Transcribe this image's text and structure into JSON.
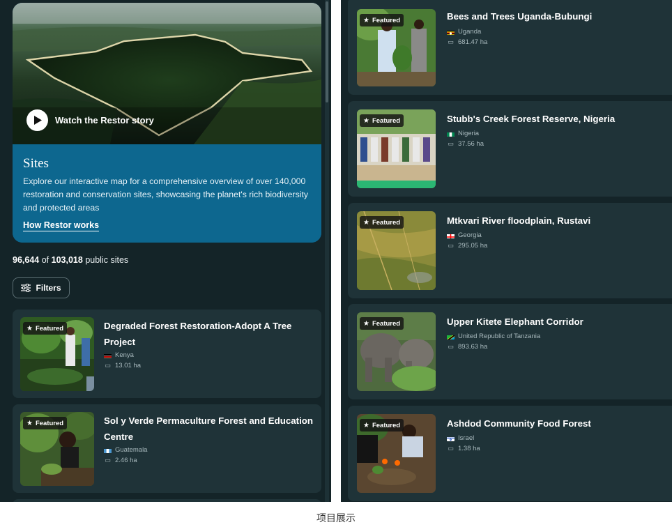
{
  "hero": {
    "watch_label": "Watch the Restor story",
    "title": "Sites",
    "description": "Explore our interactive map for a comprehensive overview of over 140,000 restoration and conservation sites, showcasing the planet's rich biodiversity and protected areas",
    "link_label": "How Restor works"
  },
  "counts": {
    "public_shown": "96,644",
    "of_word": "of",
    "total": "103,018",
    "suffix": "public sites"
  },
  "filters_label": "Filters",
  "featured_label": "Featured",
  "left_sites": [
    {
      "title_line1": "Degraded Forest Restoration-Adopt A Tree",
      "title_line2": "Project",
      "country": "Kenya",
      "area": "13.01 ha"
    },
    {
      "title_line1": "Sol y Verde Permaculture Forest and Education",
      "title_line2": "Centre",
      "country": "Guatemala",
      "area": "2.46 ha"
    }
  ],
  "right_sites": [
    {
      "title": "Bees and Trees Uganda-Bubungi",
      "country": "Uganda",
      "area": "681.47 ha"
    },
    {
      "title": "Stubb's Creek Forest Reserve, Nigeria",
      "country": "Nigeria",
      "area": "37.56 ha"
    },
    {
      "title": "Mtkvari River floodplain, Rustavi",
      "country": "Georgia",
      "area": "295.05 ha"
    },
    {
      "title": "Upper Kitete Elephant Corridor",
      "country": "United Republic of Tanzania",
      "area": "893.63 ha"
    },
    {
      "title": "Ashdod Community Food Forest",
      "country": "Israel",
      "area": "1.38 ha"
    }
  ],
  "caption": "项目展示",
  "colors": {
    "panel_bg": "#142428",
    "card_bg": "#1f3338",
    "hero_blue": "#0d678f",
    "meta_text": "#a9babe"
  },
  "icons": {
    "play": "play-icon",
    "filters": "sliders-icon",
    "star": "star-icon",
    "area": "area-icon"
  }
}
